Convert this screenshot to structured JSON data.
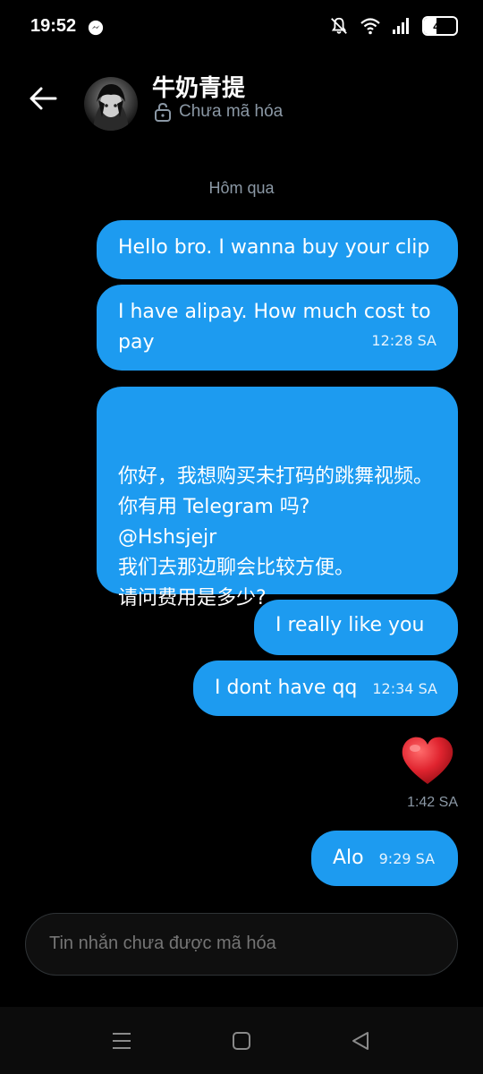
{
  "status_bar": {
    "time": "19:52",
    "battery": "40"
  },
  "header": {
    "contact_name": "牛奶青提",
    "encryption_status": "Chưa mã hóa"
  },
  "conversation": {
    "date_divider": "Hôm qua",
    "messages": [
      {
        "text": "Hello bro. I wanna buy your clip",
        "time": ""
      },
      {
        "text": "I have alipay. How much cost to pay",
        "time": "12:28 SA"
      },
      {
        "text": "你好，我想购买未打码的跳舞视频。\n你有用 Telegram 吗?\n@Hshsjejr\n我们去那边聊会比较方便。\n请问费用是多少?",
        "time": ""
      },
      {
        "text": "I really like you",
        "time": ""
      },
      {
        "text": "I dont have qq",
        "time": "12:34 SA"
      },
      {
        "text": "❤",
        "time": "1:42 SA"
      },
      {
        "text": "Alo",
        "time": "9:29 SA"
      }
    ]
  },
  "composer": {
    "placeholder": "Tin nhắn chưa được mã hóa"
  },
  "colors": {
    "bubble": "#1d9bf0",
    "background": "#000000",
    "secondary_text": "#8b98a5",
    "heart": "#e0242f"
  },
  "icons": [
    "messenger-icon",
    "mute-icon",
    "wifi-icon",
    "signal-icon",
    "battery-icon",
    "back-arrow-icon",
    "lock-icon",
    "heart-emoji-icon",
    "menu-nav-icon",
    "home-nav-icon",
    "back-nav-icon"
  ]
}
